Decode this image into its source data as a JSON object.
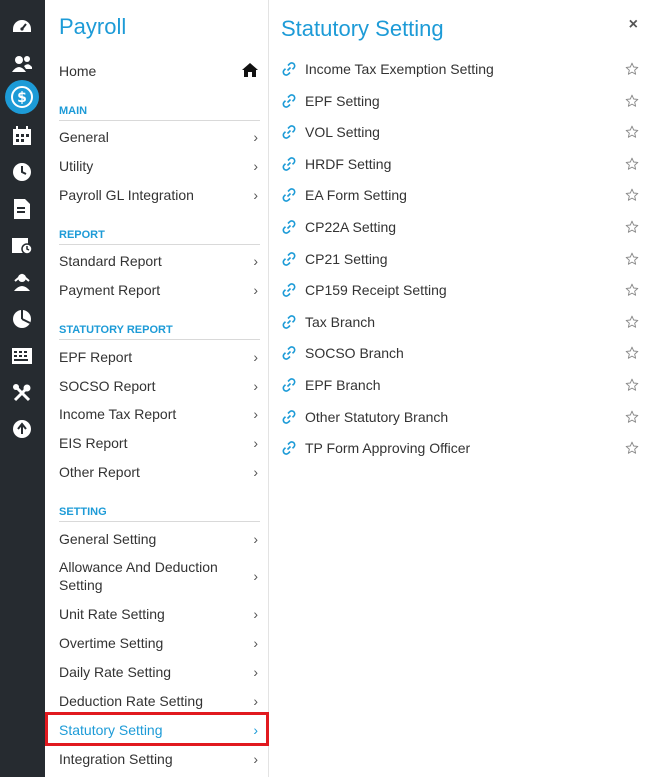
{
  "rail": {
    "icons": [
      "dashboard-icon",
      "people-icon",
      "payroll-icon",
      "calendar-icon",
      "clock-icon",
      "document-icon",
      "schedule-icon",
      "user-upload-icon",
      "pie-chart-icon",
      "keyboard-icon",
      "tools-icon",
      "upload-icon"
    ],
    "active_index": 2
  },
  "menu": {
    "title": "Payroll",
    "home_label": "Home",
    "sections": [
      {
        "heading": "MAIN",
        "items": [
          "General",
          "Utility",
          "Payroll GL Integration"
        ]
      },
      {
        "heading": "REPORT",
        "items": [
          "Standard Report",
          "Payment Report"
        ]
      },
      {
        "heading": "STATUTORY REPORT",
        "items": [
          "EPF Report",
          "SOCSO Report",
          "Income Tax Report",
          "EIS Report",
          "Other Report"
        ]
      },
      {
        "heading": "SETTING",
        "items": [
          "General Setting",
          "Allowance And Deduction Setting",
          "Unit Rate Setting",
          "Overtime Setting",
          "Daily Rate Setting",
          "Deduction Rate Setting",
          "Statutory Setting",
          "Integration Setting"
        ]
      }
    ],
    "selected_item": "Statutory Setting"
  },
  "content": {
    "title": "Statutory Setting",
    "close_label": "×",
    "items": [
      "Income Tax Exemption Setting",
      "EPF Setting",
      "VOL Setting",
      "HRDF Setting",
      "EA Form Setting",
      "CP22A Setting",
      "CP21 Setting",
      "CP159 Receipt Setting",
      "Tax Branch",
      "SOCSO Branch",
      "EPF Branch",
      "Other Statutory Branch",
      "TP Form Approving Officer"
    ]
  },
  "colors": {
    "accent": "#1d9bd7",
    "rail_bg": "#262b30",
    "highlight_border": "#e1191f"
  }
}
